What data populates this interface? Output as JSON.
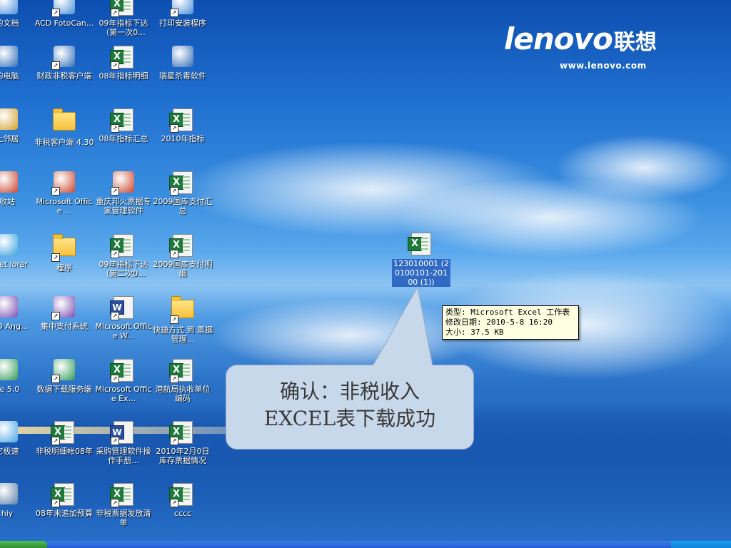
{
  "brand": {
    "name": "lenovo",
    "name_cn": "联想",
    "url": "www.lenovo.com"
  },
  "desktop_icons": [
    {
      "id": "my-documents",
      "label": "的文档",
      "type": "generic"
    },
    {
      "id": "acd-fotocanvas",
      "label": "ACD FotoCan...",
      "type": "generic"
    },
    {
      "id": "xls-09-target-1",
      "label": "09年指标下达（第一次0...",
      "type": "excel"
    },
    {
      "id": "print-installer",
      "label": "打印安装程序",
      "type": "generic"
    },
    {
      "id": "my-computer",
      "label": "的电脑",
      "type": "generic"
    },
    {
      "id": "fiscal-client",
      "label": "财政非税客户端",
      "type": "generic"
    },
    {
      "id": "xls-08-detail",
      "label": "08年指标明细",
      "type": "excel"
    },
    {
      "id": "rising-antivirus",
      "label": "瑞星杀毒软件",
      "type": "generic"
    },
    {
      "id": "network-places",
      "label": "上邻居",
      "type": "generic"
    },
    {
      "id": "nontax-client-430",
      "label": "非税客户端 4.30",
      "type": "folder"
    },
    {
      "id": "xls-08-summary",
      "label": "08年指标汇总",
      "type": "excel"
    },
    {
      "id": "xls-2010-target",
      "label": "2010年指标",
      "type": "excel"
    },
    {
      "id": "recycle-bin",
      "label": "收站",
      "type": "generic"
    },
    {
      "id": "ms-office",
      "label": "Microsoft Office ...",
      "type": "generic"
    },
    {
      "id": "cq-ticket-system",
      "label": "重庆邦火票据专家管理软件",
      "type": "generic"
    },
    {
      "id": "xls-2009-treasury-summary",
      "label": "2009国库支付汇总",
      "type": "excel"
    },
    {
      "id": "internet-explorer",
      "label": "ernet lorer",
      "type": "generic"
    },
    {
      "id": "programs-folder",
      "label": "程序",
      "type": "folder"
    },
    {
      "id": "xls-09-target-2",
      "label": "09年指标下达（第二次0...",
      "type": "excel"
    },
    {
      "id": "xls-2009-treasury-detail",
      "label": "2009国库支付明细",
      "type": "excel"
    },
    {
      "id": "acd-ang",
      "label": "ACD Ang...",
      "type": "generic"
    },
    {
      "id": "central-payment",
      "label": "集中支付系统",
      "type": "generic"
    },
    {
      "id": "ms-office-word",
      "label": "Microsoft Office W...",
      "type": "word"
    },
    {
      "id": "shortcut-ticket-mgmt",
      "label": "快捷方式 到 票据管理...",
      "type": "folder"
    },
    {
      "id": "acdsee-50",
      "label": "ee 5.0",
      "type": "generic"
    },
    {
      "id": "data-download-service",
      "label": "数据下载服务端",
      "type": "generic"
    },
    {
      "id": "ms-office-excel",
      "label": "Microsoft Office Ex...",
      "type": "excel"
    },
    {
      "id": "xls-port-bureau",
      "label": "港航局执收单位编码",
      "type": "excel"
    },
    {
      "id": "speed-browser",
      "label": "它极速",
      "type": "generic"
    },
    {
      "id": "xls-nontax-ledger",
      "label": "非税明细帐08年",
      "type": "excel"
    },
    {
      "id": "doc-purchase-manual",
      "label": "采购管理软件操作手册...",
      "type": "word"
    },
    {
      "id": "xls-2010-feb-inventory",
      "label": "2010年2月0日库存票据情况",
      "type": "excel"
    },
    {
      "id": "delphi",
      "label": "hiy",
      "type": "generic"
    },
    {
      "id": "xls-08-budget",
      "label": "08年末追加预算",
      "type": "excel"
    },
    {
      "id": "xls-nontax-ticket-issue",
      "label": "非税票据发放清单",
      "type": "excel"
    },
    {
      "id": "xls-cccc",
      "label": "cccc",
      "type": "excel"
    }
  ],
  "selected_file": {
    "label": "123010001 (20100101-20100 (1))"
  },
  "tooltip": {
    "line1": "类型: Microsoft Excel 工作表",
    "line2": "修改日期: 2010-5-8 16:20",
    "line3": "大小: 37.5 KB"
  },
  "callout": {
    "line1": "确认：非税收入",
    "line2": "EXCEL表下载成功"
  },
  "colors": {
    "excel_green": "#1d7a3a",
    "word_blue": "#2a4f9e",
    "selection": "#316ac5",
    "tooltip_bg": "#ffffe1",
    "callout_bg": "#c8d8eb"
  }
}
